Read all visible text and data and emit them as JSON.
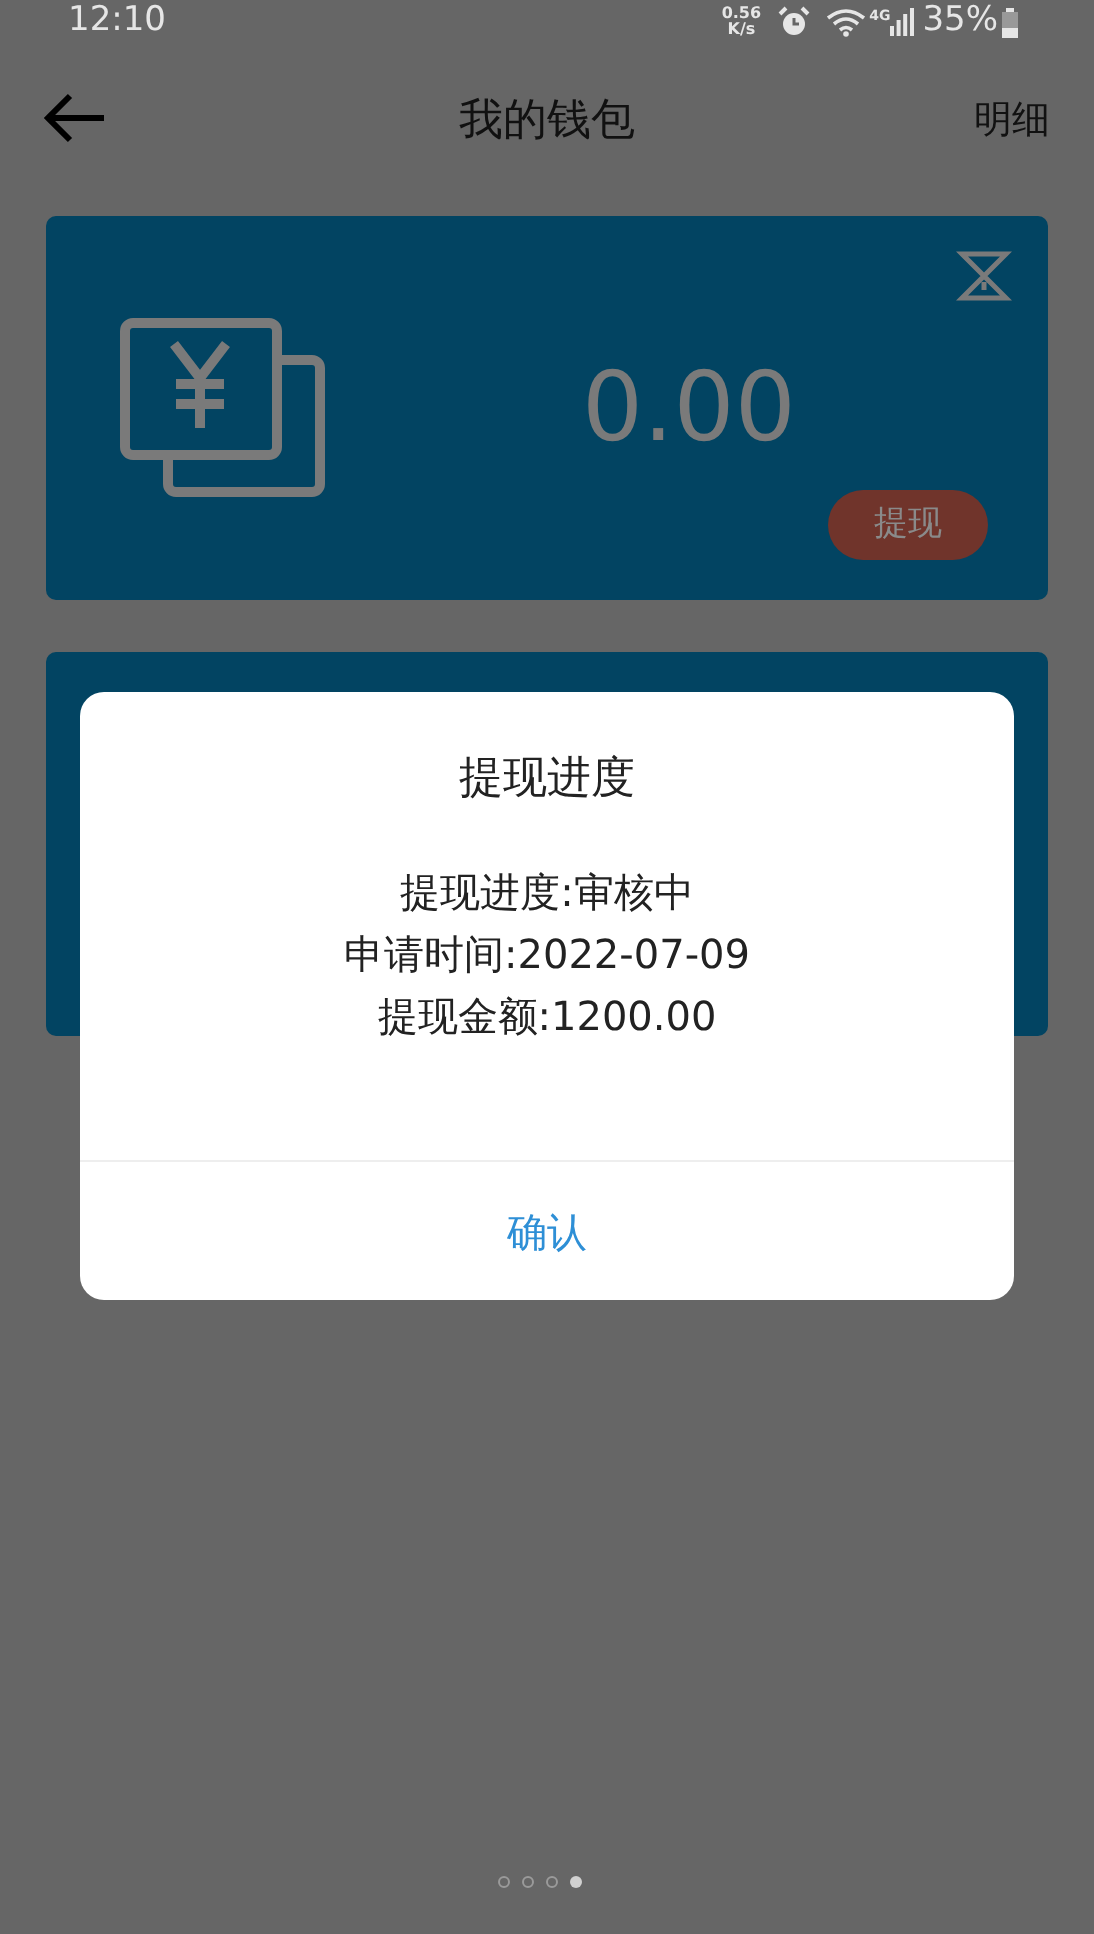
{
  "status_bar": {
    "time": "12:10",
    "speed_value": "0.56",
    "speed_unit": "K/s",
    "network": "4G",
    "battery": "35%"
  },
  "header": {
    "title": "我的钱包",
    "action": "明细"
  },
  "balance_card": {
    "amount": "0.00",
    "button": "提现"
  },
  "dialog": {
    "title": "提现进度",
    "lines": [
      "提现进度:审核中",
      "申请时间:2022-07-09",
      "提现金额:1200.00"
    ],
    "confirm": "确认"
  },
  "page_indicator": [
    {
      "selected": false
    },
    {
      "selected": false
    },
    {
      "selected": false
    },
    {
      "selected": true
    }
  ]
}
